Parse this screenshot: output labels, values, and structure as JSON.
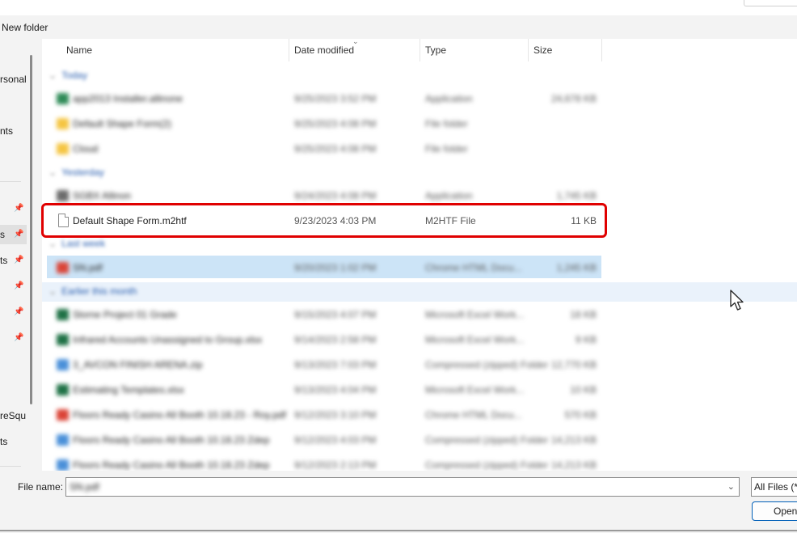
{
  "toolbar": {
    "new_folder": "New folder"
  },
  "nav": {
    "items": [
      {
        "label": "rsonal"
      },
      {
        "label": "nts"
      },
      {
        "label": "s"
      },
      {
        "label": "ts"
      },
      {
        "label": "reSqu"
      },
      {
        "label": "ts"
      }
    ]
  },
  "columns": {
    "name": "Name",
    "date": "Date modified",
    "type": "Type",
    "size": "Size"
  },
  "groups": {
    "today": "Today",
    "yesterday": "Yesterday",
    "last_week": "Last week",
    "earlier": "Earlier this month"
  },
  "rows": {
    "r1": {
      "name": "app2013 Installer.allinone",
      "date": "9/25/2023 3:52 PM",
      "type": "Application",
      "size": "24,678 KB"
    },
    "r2": {
      "name": "Default Shape Form(2)",
      "date": "9/25/2023 4:08 PM",
      "type": "File folder"
    },
    "r3": {
      "name": "Cloud",
      "date": "9/25/2023 4:08 PM",
      "type": "File folder"
    },
    "r4": {
      "name": "SGBX Allinon",
      "date": "9/24/2023 4:08 PM",
      "type": "Application",
      "size": "1,745 KB"
    },
    "r5": {
      "name": "Default Shape Form.m2htf",
      "date": "9/23/2023 4:03 PM",
      "type": "M2HTF File",
      "size": "11 KB"
    },
    "r6": {
      "name": "SN.pdf",
      "date": "9/20/2023 1:02 PM",
      "type": "Chrome HTML Docu...",
      "size": "1,245 KB"
    },
    "r7": {
      "name": "Slorne Project 01 Grade",
      "date": "9/15/2023 4:07 PM",
      "type": "Microsoft Excel Work...",
      "size": "18 KB"
    },
    "r8": {
      "name": "Infrared Accounts Unassigned to Group.xlsx",
      "date": "9/14/2023 2:58 PM",
      "type": "Microsoft Excel Work...",
      "size": "9 KB"
    },
    "r9": {
      "name": "3_AVCON FINISH ARENA.zip",
      "date": "9/13/2023 7:03 PM",
      "type": "Compressed (zipped) Folder",
      "size": "12,770 KB"
    },
    "r10": {
      "name": "Estimating Templates.xlsx",
      "date": "9/13/2023 4:04 PM",
      "type": "Microsoft Excel Work...",
      "size": "10 KB"
    },
    "r11": {
      "name": "Floors Ready Casino All Booth 10.18.23 - Roy.pdf",
      "date": "9/12/2023 3:10 PM",
      "type": "Chrome HTML Docu...",
      "size": "570 KB"
    },
    "r12": {
      "name": "Floors Ready Casino All Booth 10.18.23 Zdep",
      "date": "9/12/2023 4:03 PM",
      "type": "Compressed (zipped) Folder",
      "size": "14,213 KB"
    },
    "r13": {
      "name": "Floors Ready Casino All Booth 10.18.23 Zdep",
      "date": "9/12/2023 2:13 PM",
      "type": "Compressed (zipped) Folder",
      "size": "14,213 KB"
    }
  },
  "bottom": {
    "file_name_label": "File name:",
    "file_name_value": "SN.pdf",
    "filter_value": "All Files (*.*)",
    "open_label": "Open"
  },
  "colors": {
    "highlight": "#e00000",
    "selected_row": "#cce4f7",
    "accent": "#005fb8"
  }
}
